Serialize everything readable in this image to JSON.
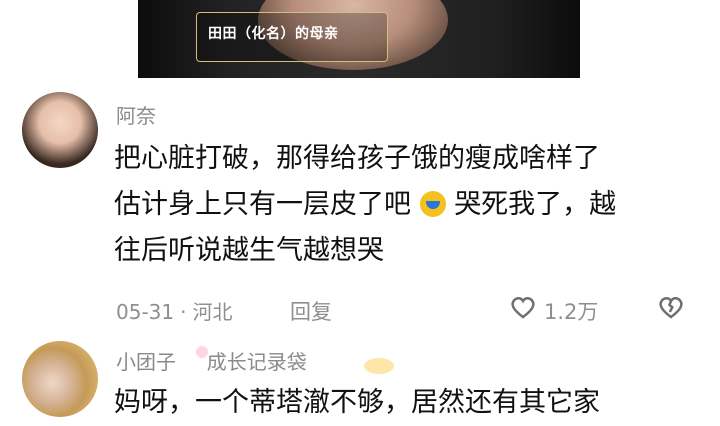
{
  "video": {
    "caption": "田田（化名）的母亲"
  },
  "comments": [
    {
      "username": "阿奈",
      "avatar_icon": "kid-portrait",
      "lines": [
        "把心脏打破，那得给孩子饿的瘦成啥样了",
        "估计身上只有一层皮了吧",
        "哭死我了，越",
        "往后听说越生气越想哭"
      ],
      "emoji": "crying-face",
      "date": "05-31",
      "location": "河北",
      "reply_label": "回复",
      "likes": "1.2万",
      "colors": {
        "emoji": "#f4c21c"
      }
    },
    {
      "username": "小团子",
      "username_suffix": "成长记录袋",
      "avatar_icon": "family-portrait",
      "first_line": "妈呀，一个蒂塔澈不够，居然还有其它家"
    }
  ]
}
